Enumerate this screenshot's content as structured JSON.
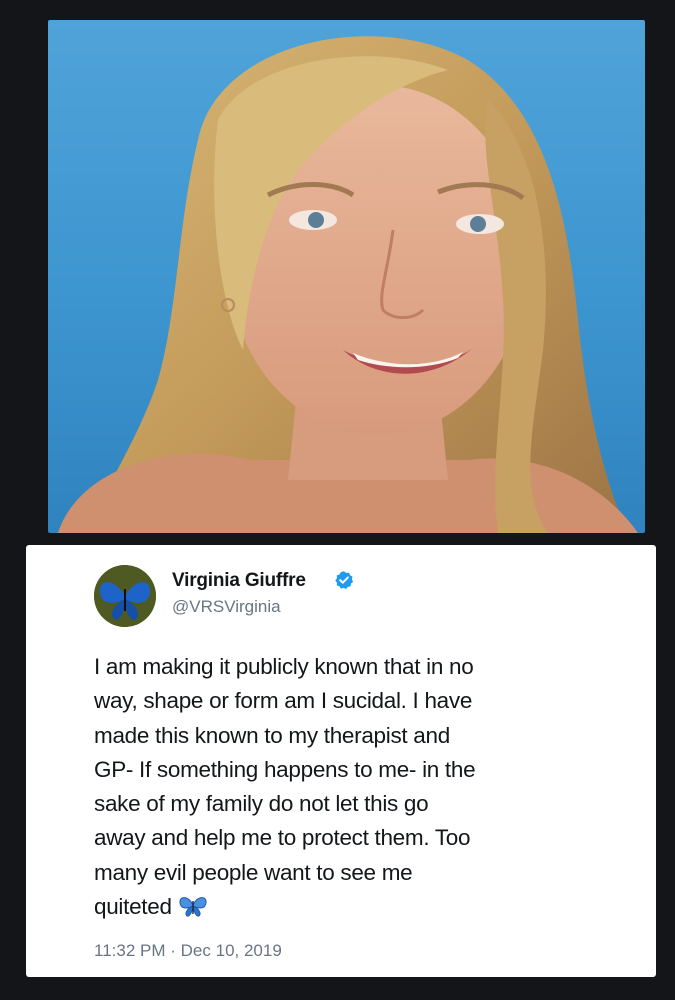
{
  "photo": {
    "icon": "portrait-photo"
  },
  "tweet": {
    "avatar_icon": "blue-butterfly-icon",
    "display_name": "Virginia Giuffre",
    "verified_icon": "verified-badge-icon",
    "handle": "@VRSVirginia",
    "text": "I am making it publicly known that in no\nway, shape or form am I sucidal. I have\nmade this known to my therapist and\nGP- If something happens to me- in the\nsake of my family do not let this go\naway and help me to protect them. Too\nmany evil people want to see me\nquiteted",
    "text_emoji": "blue-butterfly-icon",
    "time": "11:32 PM",
    "separator": "·",
    "date": "Dec 10, 2019"
  },
  "colors": {
    "background": "#141518",
    "card": "#ffffff",
    "text": "#14171a",
    "muted": "#687684",
    "verified": "#1d9bf0",
    "sky": "#4fa3d9"
  }
}
